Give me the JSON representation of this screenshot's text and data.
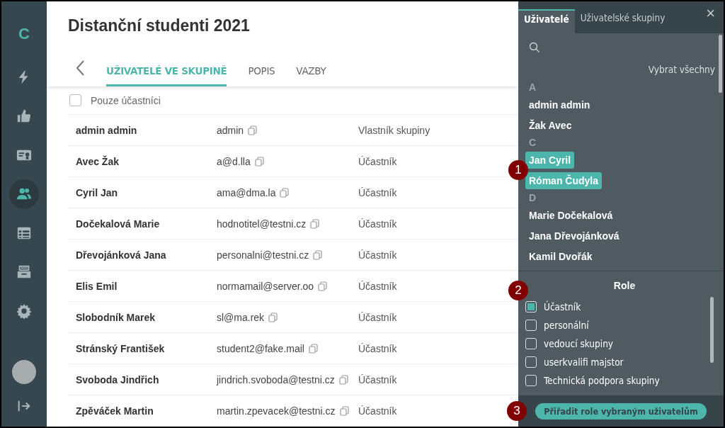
{
  "nav": {
    "logo": "C",
    "items": [
      {
        "selected": false
      },
      {
        "selected": false
      },
      {
        "selected": false
      },
      {
        "selected": true
      },
      {
        "selected": false
      },
      {
        "selected": false
      },
      {
        "selected": false
      }
    ]
  },
  "page": {
    "title": "Distanční studenti 2021",
    "tabs": [
      {
        "label": "UŽIVATELÉ VE SKUPINĚ",
        "selected": true
      },
      {
        "label": "POPIS",
        "selected": false
      },
      {
        "label": "VAZBY",
        "selected": false
      }
    ],
    "filter": {
      "label": "Pouze účastníci",
      "checked": false
    },
    "rows": [
      {
        "name": "admin admin",
        "email": "admin",
        "role": "Vlastník skupiny"
      },
      {
        "name": "Avec Žak",
        "email": "a@d.lla",
        "role": "Účastník"
      },
      {
        "name": "Cyril Jan",
        "email": "ama@dma.la",
        "role": "Účastník"
      },
      {
        "name": "Dočekalová Marie",
        "email": "hodnotitel@testni.cz",
        "role": "Účastník"
      },
      {
        "name": "Dřevojánková Jana",
        "email": "personalni@testni.cz",
        "role": "Účastník"
      },
      {
        "name": "Elis Emil",
        "email": "normamail@server.oo",
        "role": "Účastník"
      },
      {
        "name": "Slobodník Marek",
        "email": "sl@ma.rek",
        "role": "Účastník"
      },
      {
        "name": "Stránský František",
        "email": "student2@fake.mail",
        "role": "Účastník"
      },
      {
        "name": "Svoboda Jindřich",
        "email": "jindrich.svoboda@testni.cz",
        "role": "Účastník"
      },
      {
        "name": "Zpěváček Martin",
        "email": "martin.zpevacek@testni.cz",
        "role": "Účastník"
      }
    ]
  },
  "panel": {
    "close": "×",
    "tabs": [
      {
        "label": "Uživatelé",
        "selected": true
      },
      {
        "label": "Uživatelské skupiny",
        "selected": false
      }
    ],
    "select_all": "Vybrat všechny",
    "groups": [
      {
        "letter": "A",
        "users": [
          {
            "name": "admin admin",
            "selected": false
          },
          {
            "name": "Žak Avec",
            "selected": false
          }
        ]
      },
      {
        "letter": "C",
        "users": [
          {
            "name": "Jan Cyril",
            "selected": true
          },
          {
            "name": "Róman Čudyla",
            "selected": true
          }
        ]
      },
      {
        "letter": "D",
        "users": [
          {
            "name": "Marie Dočekalová",
            "selected": false
          },
          {
            "name": "Jana Dřevojánková",
            "selected": false
          },
          {
            "name": "Kamil Dvořák",
            "selected": false
          }
        ]
      }
    ],
    "roles": {
      "title": "Role",
      "items": [
        {
          "label": "Účastník",
          "checked": true
        },
        {
          "label": "personální",
          "checked": false
        },
        {
          "label": "vedoucí skupiny",
          "checked": false
        },
        {
          "label": "userkvalifi majstor",
          "checked": false
        },
        {
          "label": "Technická podpora skupiny",
          "checked": false
        }
      ]
    },
    "assign_button": "Přiřadit role vybraným uživatelům"
  },
  "callouts": [
    "1",
    "2",
    "3"
  ]
}
